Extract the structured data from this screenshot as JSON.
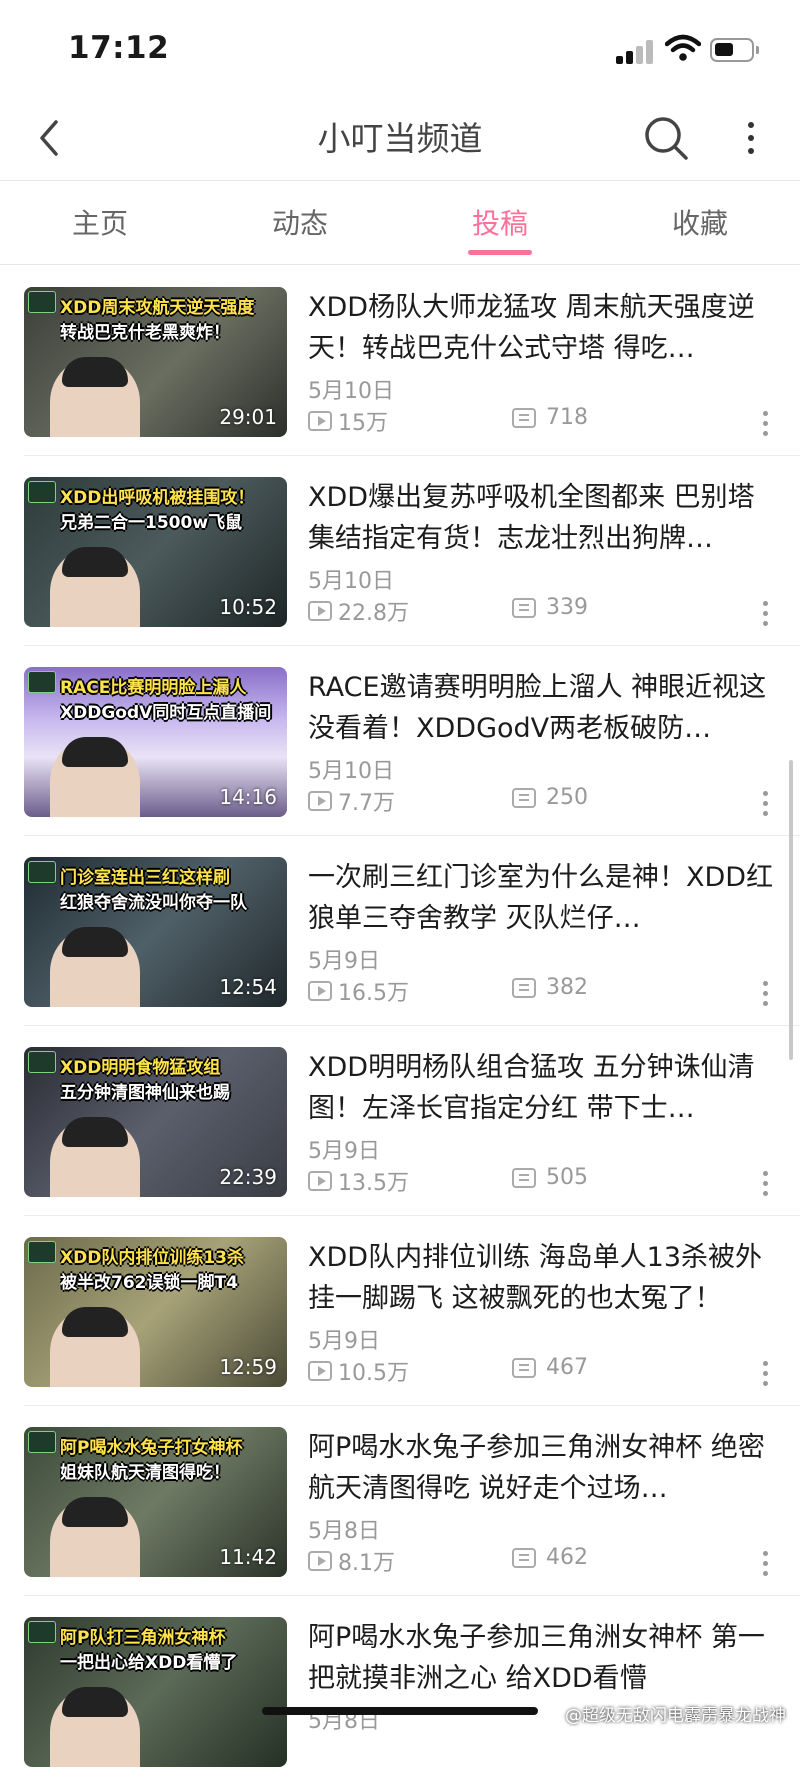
{
  "status_bar": {
    "time": "17:12"
  },
  "nav": {
    "title": "小叮当频道"
  },
  "tabs": [
    {
      "label": "主页",
      "active": false
    },
    {
      "label": "动态",
      "active": false
    },
    {
      "label": "投稿",
      "active": true
    },
    {
      "label": "收藏",
      "active": false
    }
  ],
  "accent_color": "#fb7299",
  "videos": [
    {
      "title": "XDD杨队大师龙猛攻 周末航天强度逆天！转战巴克什公式守塔 得吃…",
      "date": "5月10日",
      "views": "15万",
      "comments": "718",
      "duration": "29:01",
      "thumb_caption_1": "XDD周末攻航天逆天强度",
      "thumb_caption_2": "转战巴克什老黑爽炸！"
    },
    {
      "title": "XDD爆出复苏呼吸机全图都来 巴别塔集结指定有货！志龙壮烈出狗牌…",
      "date": "5月10日",
      "views": "22.8万",
      "comments": "339",
      "duration": "10:52",
      "thumb_caption_1": "XDD出呼吸机被挂围攻！",
      "thumb_caption_2": "兄弟二合一1500w飞鼠"
    },
    {
      "title": "RACE邀请赛明明脸上溜人 神眼近视这没看着！XDDGodV两老板破防…",
      "date": "5月10日",
      "views": "7.7万",
      "comments": "250",
      "duration": "14:16",
      "thumb_caption_1": "RACE比赛明明脸上漏人",
      "thumb_caption_2": "XDDGodV同时互点直播间"
    },
    {
      "title": "一次刷三红门诊室为什么是神！XDD红狼单三夺舍教学 灭队烂仔…",
      "date": "5月9日",
      "views": "16.5万",
      "comments": "382",
      "duration": "12:54",
      "thumb_caption_1": "门诊室连出三红这样刷",
      "thumb_caption_2": "红狼夺舍流没叫你夺一队"
    },
    {
      "title": "XDD明明杨队组合猛攻 五分钟诛仙清图！左泽长官指定分红 带下士…",
      "date": "5月9日",
      "views": "13.5万",
      "comments": "505",
      "duration": "22:39",
      "thumb_caption_1": "XDD明明食物猛攻组",
      "thumb_caption_2": "五分钟清图神仙来也踢"
    },
    {
      "title": "XDD队内排位训练 海岛单人13杀被外挂一脚踢飞 这被飘死的也太冤了！",
      "date": "5月9日",
      "views": "10.5万",
      "comments": "467",
      "duration": "12:59",
      "thumb_caption_1": "XDD队内排位训练13杀",
      "thumb_caption_2": "被半改762误锁一脚T4"
    },
    {
      "title": "阿P喝水水兔子参加三角洲女神杯 绝密航天清图得吃 说好走个过场…",
      "date": "5月8日",
      "views": "8.1万",
      "comments": "462",
      "duration": "11:42",
      "thumb_caption_1": "阿P喝水水兔子打女神杯",
      "thumb_caption_2": "姐妹队航天清图得吃！"
    },
    {
      "title": "阿P喝水水兔子参加三角洲女神杯 第一把就摸非洲之心 给XDD看懵",
      "date": "5月8日",
      "views": "",
      "comments": "",
      "duration": "",
      "thumb_caption_1": "阿P队打三角洲女神杯",
      "thumb_caption_2": "一把出心给XDD看懵了"
    }
  ],
  "watermark": "@超级无敌闪电霹雳暴龙战神"
}
